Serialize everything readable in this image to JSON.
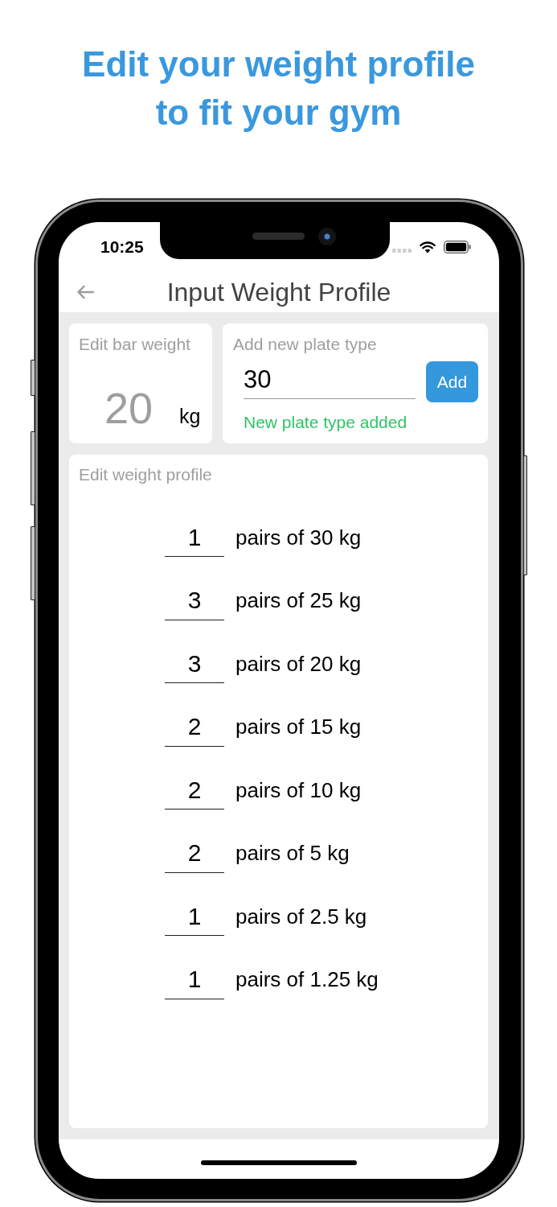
{
  "headline": {
    "lines": [
      "Edit your weight profile",
      "to fit your gym"
    ]
  },
  "status_bar": {
    "time": "10:25"
  },
  "app_bar": {
    "title": "Input Weight Profile"
  },
  "bar_weight": {
    "label": "Edit bar weight",
    "placeholder": "20",
    "unit": "kg"
  },
  "new_plate": {
    "label": "Add new plate type",
    "value": "30",
    "button": "Add",
    "message": "New plate type added"
  },
  "weight_profile": {
    "label": "Edit weight profile",
    "rows": [
      {
        "count": "1",
        "label": "pairs of 30 kg"
      },
      {
        "count": "3",
        "label": "pairs of 25 kg"
      },
      {
        "count": "3",
        "label": "pairs of 20 kg"
      },
      {
        "count": "2",
        "label": "pairs of 15 kg"
      },
      {
        "count": "2",
        "label": "pairs of 10 kg"
      },
      {
        "count": "2",
        "label": "pairs of 5 kg"
      },
      {
        "count": "1",
        "label": "pairs of 2.5 kg"
      },
      {
        "count": "1",
        "label": "pairs of 1.25 kg"
      }
    ]
  }
}
